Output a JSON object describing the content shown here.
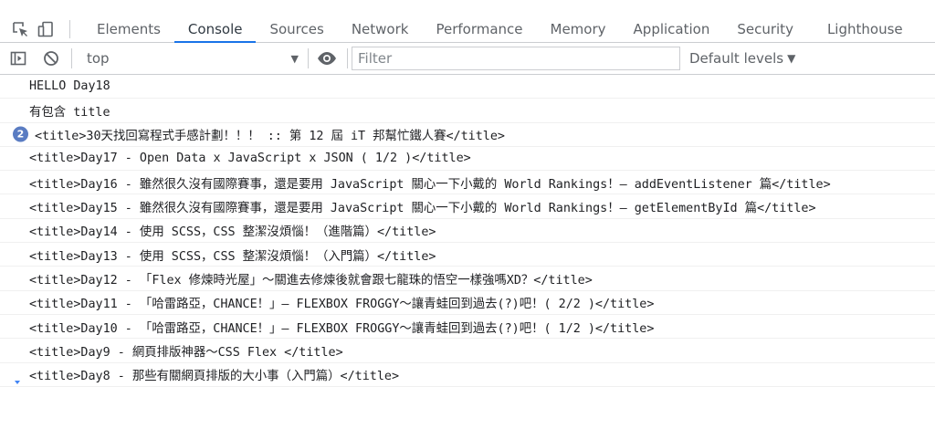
{
  "tabbar": {
    "tabs": [
      {
        "label": "Elements"
      },
      {
        "label": "Console"
      },
      {
        "label": "Sources"
      },
      {
        "label": "Network"
      },
      {
        "label": "Performance"
      },
      {
        "label": "Memory"
      },
      {
        "label": "Application"
      },
      {
        "label": "Security"
      },
      {
        "label": "Lighthouse"
      }
    ],
    "active_tab": "Console"
  },
  "toolbar": {
    "context": "top",
    "filter_placeholder": "Filter",
    "filter_value": "",
    "levels_label": "Default levels"
  },
  "messages": [
    {
      "text": "HELLO Day18"
    },
    {
      "text": "有包含 title"
    },
    {
      "badge": "2",
      "text": "<title>30天找回寫程式手感計劃！！！ :: 第 12 屆 iT 邦幫忙鐵人賽</title>"
    },
    {
      "text": "<title>Day17 - Open Data x JavaScript x JSON ( 1/2 )</title>"
    },
    {
      "text": "<title>Day16 - 雖然很久沒有國際賽事，還是要用 JavaScript 關心一下小戴的 World Rankings！— addEventListener 篇</title>"
    },
    {
      "text": "<title>Day15 - 雖然很久沒有國際賽事，還是要用 JavaScript 關心一下小戴的 World Rankings！— getElementById 篇</title>"
    },
    {
      "text": "<title>Day14 - 使用 SCSS，CSS 整潔沒煩惱！（進階篇）</title>"
    },
    {
      "text": "<title>Day13 - 使用 SCSS，CSS 整潔沒煩惱！（入門篇）</title>"
    },
    {
      "text": "<title>Day12 - 「Flex 修煉時光屋」～關進去修煉後就會跟七龍珠的悟空一樣強嗎XD？</title>"
    },
    {
      "text": "<title>Day11 - 「哈雷路亞，CHANCE！」— FLEXBOX FROGGY～讓青蛙回到過去(?)吧！( 2/2 )</title>"
    },
    {
      "text": "<title>Day10 - 「哈雷路亞，CHANCE！」— FLEXBOX FROGGY～讓青蛙回到過去(?)吧！( 1/2 )</title>"
    },
    {
      "text": "<title>Day9 - 網頁排版神器～CSS Flex </title>"
    },
    {
      "text": "<title>Day8 - 那些有關網頁排版的大小事（入門篇）</title>"
    }
  ],
  "colors": {
    "accent": "#1a73e8",
    "badge": "#5a7cc2"
  }
}
